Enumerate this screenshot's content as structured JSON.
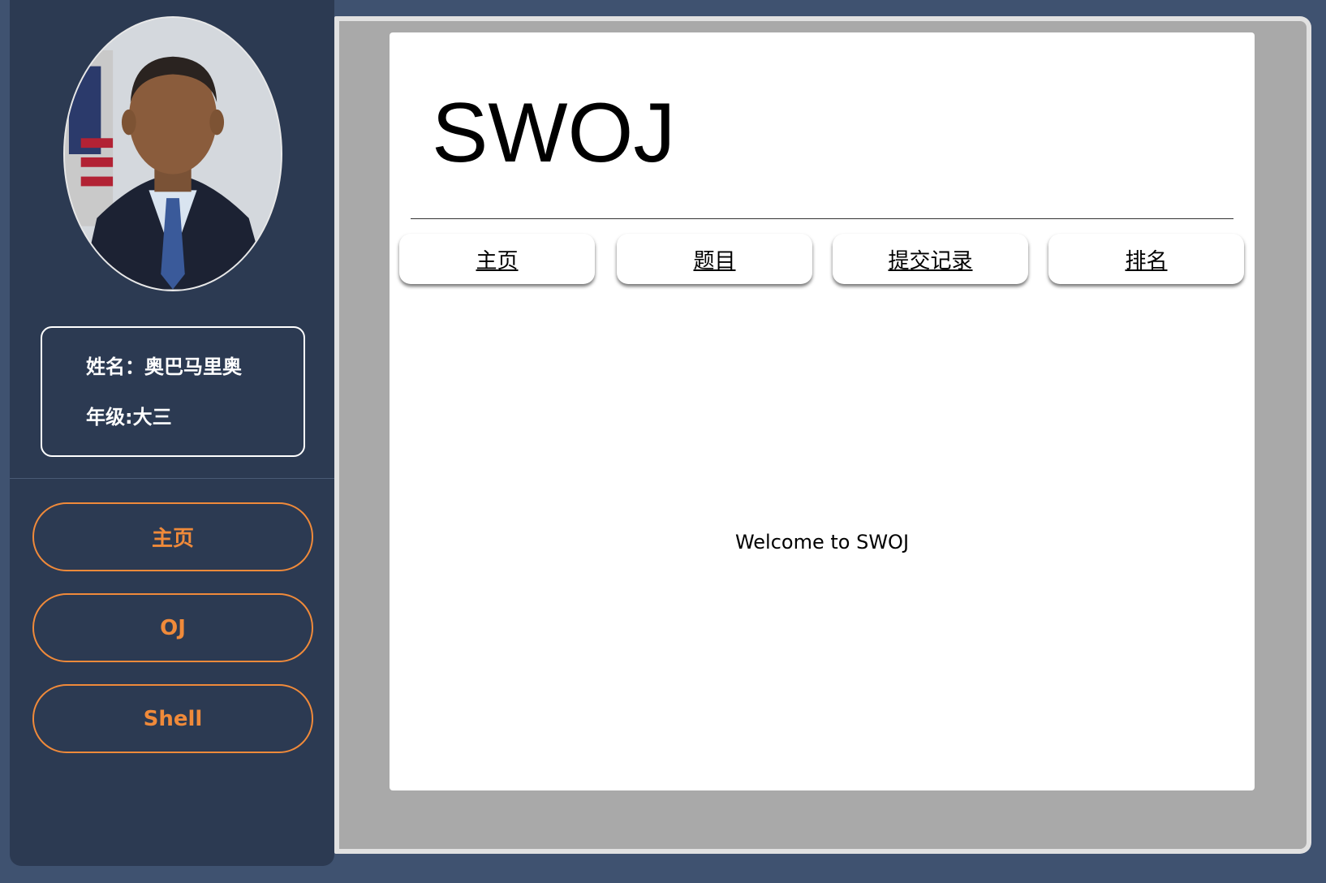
{
  "profile": {
    "name_line": "姓名：奥巴马里奥",
    "grade_line": "年级:大三"
  },
  "sidebar": {
    "items": [
      {
        "label": "主页"
      },
      {
        "label": "OJ"
      },
      {
        "label": "Shell"
      }
    ]
  },
  "main": {
    "title": "SWOJ",
    "tabs": [
      {
        "label": "主页"
      },
      {
        "label": "题目"
      },
      {
        "label": "提交记录"
      },
      {
        "label": "排名"
      }
    ],
    "welcome": "Welcome to SWOJ"
  },
  "colors": {
    "page_bg": "#3f5270",
    "sidebar_bg": "#2c3a52",
    "accent": "#f08a3a"
  }
}
